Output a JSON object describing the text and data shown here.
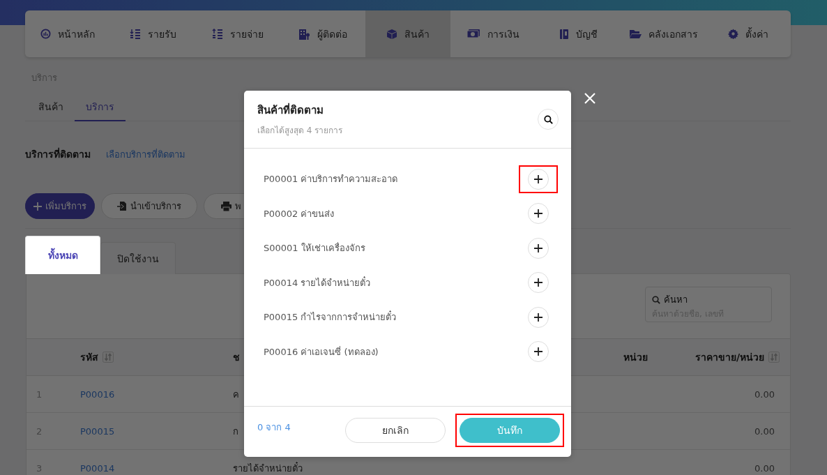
{
  "nav": {
    "items": [
      {
        "label": "หน้าหลัก",
        "selected": false
      },
      {
        "label": "รายรับ",
        "selected": false
      },
      {
        "label": "รายจ่าย",
        "selected": false
      },
      {
        "label": "ผู้ติดต่อ",
        "selected": false
      },
      {
        "label": "สินค้า",
        "selected": true
      },
      {
        "label": "การเงิน",
        "selected": false
      },
      {
        "label": "บัญชี",
        "selected": false
      },
      {
        "label": "คลังเอกสาร",
        "selected": false
      },
      {
        "label": "ตั้งค่า",
        "selected": false
      }
    ]
  },
  "breadcrumb": "บริการ",
  "sub_tabs": [
    {
      "label": "สินค้า",
      "selected": false
    },
    {
      "label": "บริการ",
      "selected": true
    }
  ],
  "section": {
    "title": "บริการที่ติดตาม",
    "link": "เลือกบริการที่ติดตาม"
  },
  "actions": [
    {
      "label": "เพิ่มบริการ",
      "kind": "primary"
    },
    {
      "label": "นำเข้าบริการ",
      "kind": "import"
    },
    {
      "label": "พ",
      "kind": "print"
    }
  ],
  "list_tabs": [
    {
      "label": "ทั้งหมด",
      "selected": true
    },
    {
      "label": "ปิดใช้งาน",
      "selected": false
    }
  ],
  "search": {
    "label": "ค้นหา",
    "placeholder": "ค้นหาด้วยชื่อ, เลขที่"
  },
  "table": {
    "columns": [
      {
        "label": "รหัส",
        "sortable": true
      },
      {
        "label": "ช"
      },
      {
        "label": "หน่วย",
        "sortable": false
      },
      {
        "label": "ราคาขาย/หน่วย",
        "sortable": true
      }
    ],
    "rows": [
      {
        "index": "1",
        "code": "P00016",
        "name": "ค",
        "price": "0.00"
      },
      {
        "index": "2",
        "code": "P00015",
        "name": "ก",
        "price": "0.00"
      },
      {
        "index": "3",
        "code": "P00014",
        "name": "รายได้จำหน่ายตั๋ว",
        "price": "0.00"
      }
    ]
  },
  "modal": {
    "title": "สินค้าที่ติดตาม",
    "subtitle": "เลือกได้สูงสุด 4 รายการ",
    "items": [
      {
        "label": "P00001 ค่าบริการทำความสะอาด",
        "highlighted": true
      },
      {
        "label": "P00002 ค่าขนส่ง",
        "highlighted": false
      },
      {
        "label": "S00001 ให้เช่าเครื่องจักร",
        "highlighted": false
      },
      {
        "label": "P00014 รายได้จำหน่ายตั๋ว",
        "highlighted": false
      },
      {
        "label": "P00015 กำไรจากการจำหน่ายตั๋ว",
        "highlighted": false
      },
      {
        "label": "P00016 ค่าเอเจนซี่ (ทดลอง)",
        "highlighted": false
      }
    ],
    "counter": "0 จาก 4",
    "buttons": [
      {
        "label": "ยกเลิก",
        "kind": "cancel",
        "highlighted": false
      },
      {
        "label": "บันทึก",
        "kind": "save",
        "highlighted": true
      }
    ]
  }
}
